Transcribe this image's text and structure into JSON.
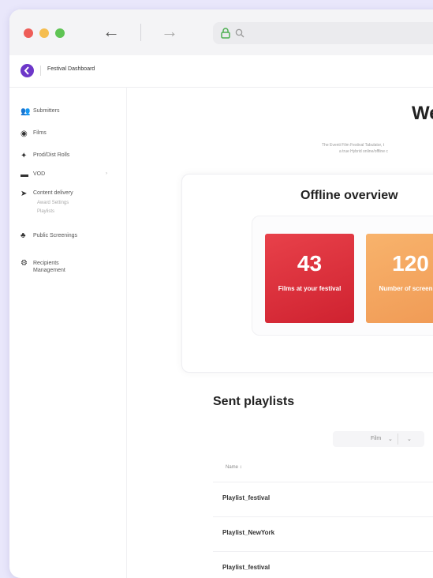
{
  "colors": {
    "accent": "#6d37c9",
    "stat1": "#e0313d",
    "stat2": "#f4a35f"
  },
  "browser": {
    "lock_icon": "lock-icon",
    "search_icon": "search-icon",
    "back_icon": "arrow-left-icon",
    "forward_icon": "arrow-right-icon"
  },
  "app": {
    "title": "Festival Dashboard"
  },
  "sidebar": {
    "items": [
      {
        "label": "Submitters",
        "icon": "users-icon"
      },
      {
        "label": "Films",
        "icon": "film-reel-icon"
      },
      {
        "label": "Prod/Dist Rolls",
        "icon": "megaphone-icon"
      },
      {
        "label": "VOD",
        "icon": "screen-icon"
      },
      {
        "label": "Content delivery",
        "icon": "send-icon"
      },
      {
        "label": "Public Screenings",
        "icon": "group-icon"
      },
      {
        "label": "Recipients Management",
        "icon": "settings-people-icon"
      }
    ],
    "sub_items": [
      "Award Settings",
      "Playlists"
    ]
  },
  "main": {
    "welcome": "We",
    "intro_line1": "The Eventi Film Festival Tabulator, t",
    "intro_line2": "a true Hybrid online/offline c"
  },
  "overview": {
    "title": "Offline overview",
    "stats": [
      {
        "value": "43",
        "label": "Films at your festival"
      },
      {
        "value": "120",
        "label": "Number of screening pl"
      }
    ]
  },
  "sent": {
    "title": "Sent playlists",
    "filter_label": "Film",
    "column_header": "Name ↕",
    "rows": [
      "Playlist_festival",
      "Playlist_NewYork",
      "Playlist_festival"
    ]
  }
}
